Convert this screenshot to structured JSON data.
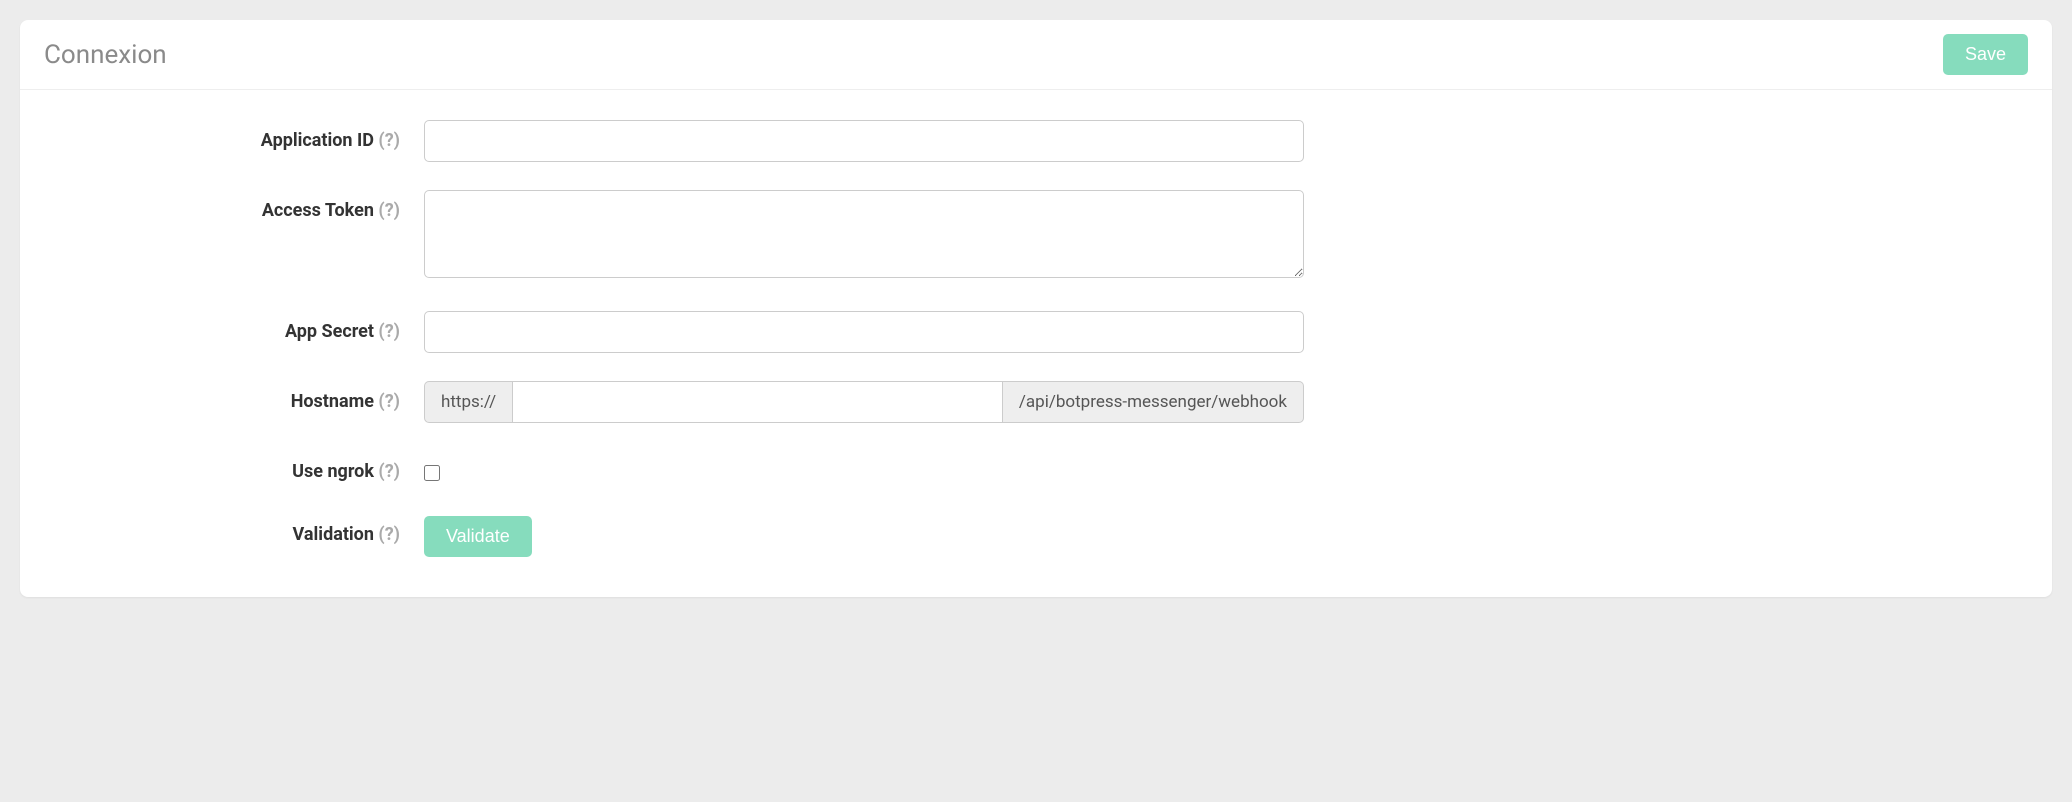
{
  "header": {
    "title": "Connexion",
    "save_label": "Save"
  },
  "form": {
    "applicationId": {
      "label": "Application ID",
      "help": "(?)",
      "value": ""
    },
    "accessToken": {
      "label": "Access Token",
      "help": "(?)",
      "value": ""
    },
    "appSecret": {
      "label": "App Secret",
      "help": "(?)",
      "value": ""
    },
    "hostname": {
      "label": "Hostname",
      "help": "(?)",
      "prefix": "https://",
      "value": "",
      "suffix": "/api/botpress-messenger/webhook"
    },
    "useNgrok": {
      "label": "Use ngrok",
      "help": "(?)",
      "checked": false
    },
    "validation": {
      "label": "Validation",
      "help": "(?)",
      "button_label": "Validate"
    }
  }
}
